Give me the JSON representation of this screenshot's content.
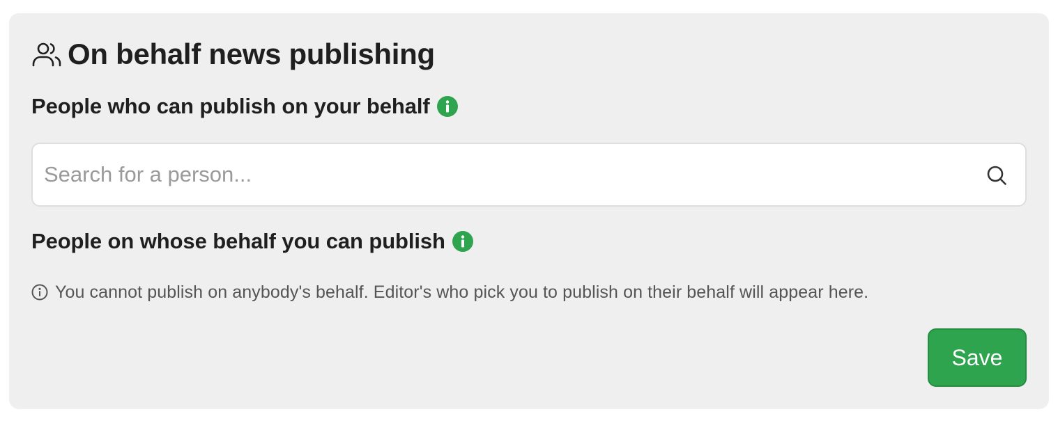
{
  "header": {
    "icon": "users-icon",
    "title": "On behalf news publishing"
  },
  "publishers_section": {
    "label": "People who can publish on your behalf",
    "info_icon": "info-icon",
    "search": {
      "placeholder": "Search for a person...",
      "value": "",
      "icon": "search-icon"
    }
  },
  "behalf_section": {
    "label": "People on whose behalf you can publish",
    "info_icon": "info-icon",
    "empty_note_icon": "info-outline-icon",
    "empty_note": "You cannot publish on anybody's behalf. Editor's who pick you to publish on their behalf will appear here."
  },
  "actions": {
    "save_label": "Save"
  },
  "colors": {
    "card_background": "#efefef",
    "accent_green": "#2ea44f",
    "text_primary": "#1f1f1f",
    "text_muted": "#555555",
    "placeholder": "#9a9a9a"
  }
}
